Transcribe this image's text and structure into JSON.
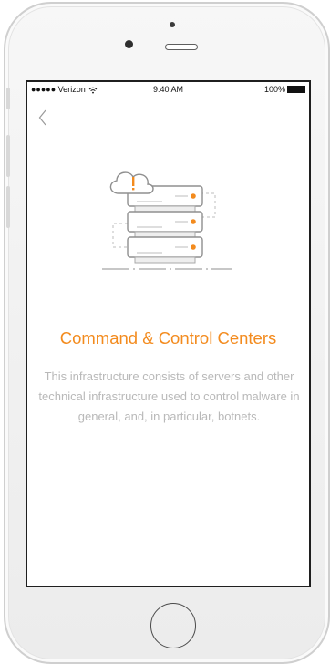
{
  "status_bar": {
    "carrier": "●●●●● Verizon",
    "time": "9:40 AM",
    "battery": "100%"
  },
  "screen": {
    "title": "Command & Control Centers",
    "description": "This infrastructure consists of servers and other technical infrastructure used to control malware in general, and, in particular, botnets."
  },
  "colors": {
    "accent": "#f38b1e",
    "description_text": "#b9b9b9",
    "illustration_stroke": "#8f8f8f"
  },
  "icons": {
    "back": "chevron-left-icon",
    "illustration": "server-stack-alert-icon",
    "wifi": "wifi-icon",
    "battery": "battery-icon"
  }
}
